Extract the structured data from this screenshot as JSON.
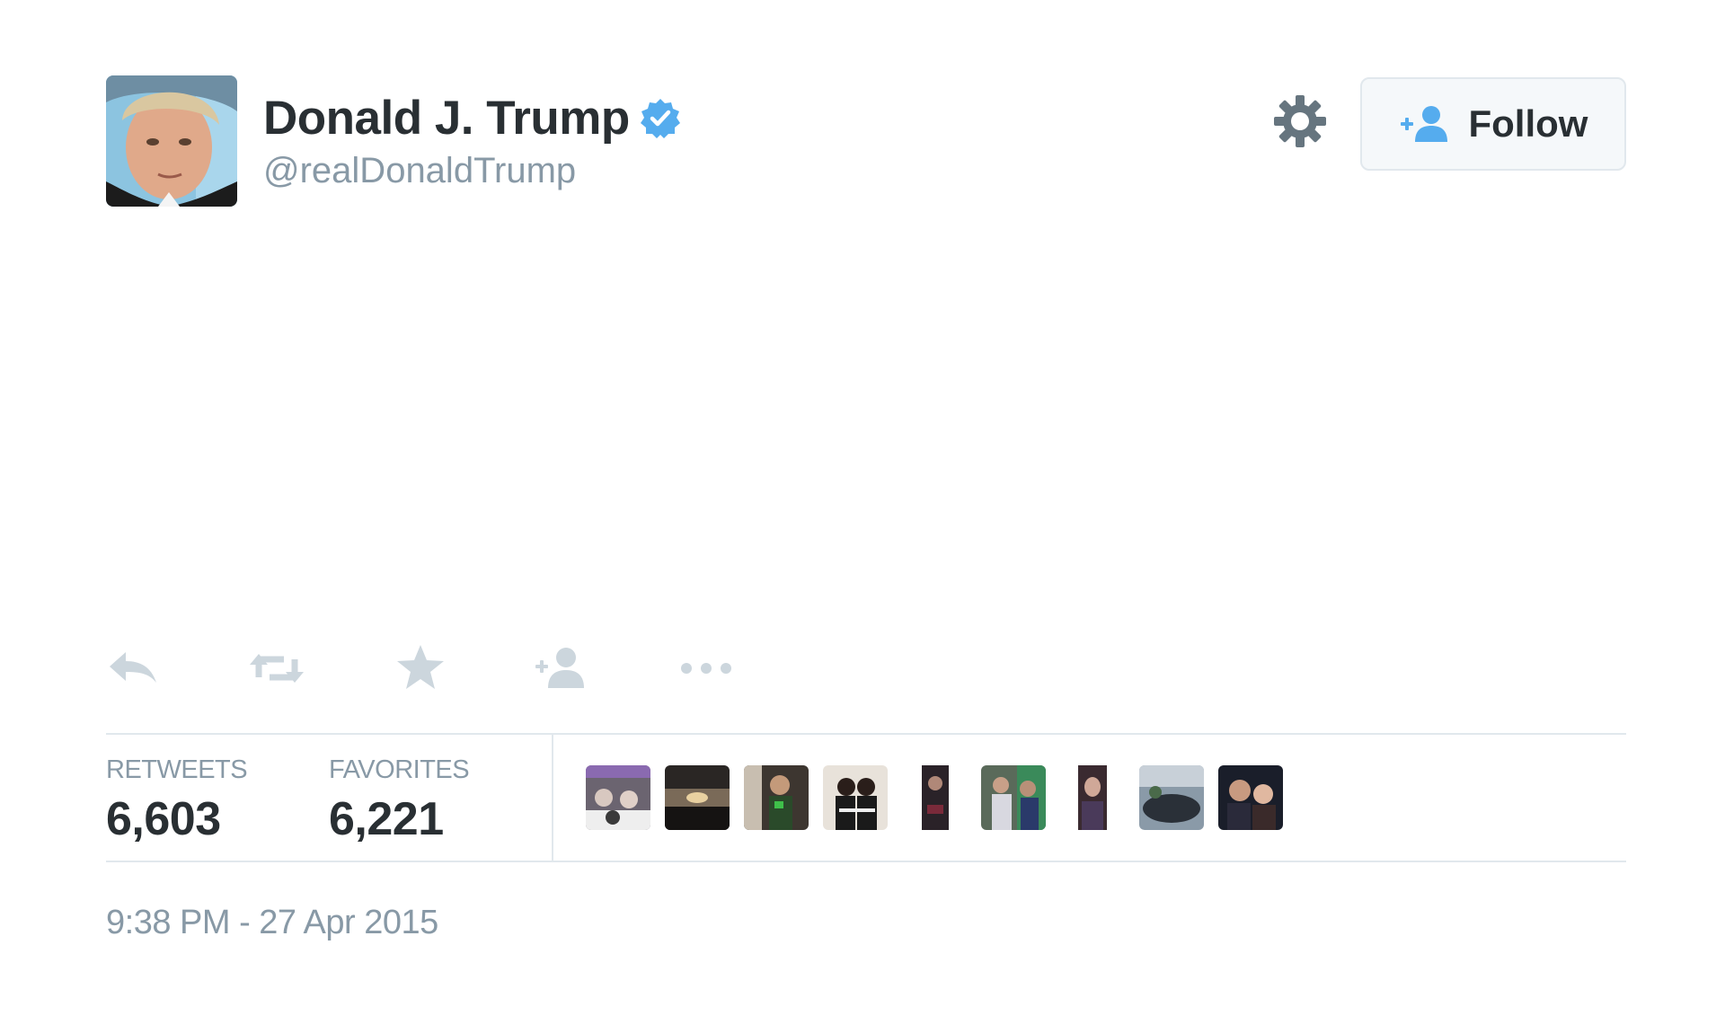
{
  "header": {
    "fullname": "Donald J. Trump",
    "handle": "@realDonaldTrump",
    "verified": true,
    "verified_icon": "verified-badge-icon",
    "settings_icon": "gear-icon",
    "follow_label": "Follow",
    "follow_icon": "add-user-icon"
  },
  "actions": [
    {
      "name": "reply",
      "icon": "reply-icon"
    },
    {
      "name": "retweet",
      "icon": "retweet-icon"
    },
    {
      "name": "favorite",
      "icon": "star-icon"
    },
    {
      "name": "follow",
      "icon": "add-user-icon"
    },
    {
      "name": "more",
      "icon": "more-dots-icon"
    }
  ],
  "stats": {
    "retweets_label": "RETWEETS",
    "retweets_value": "6,603",
    "favorites_label": "FAVORITES",
    "favorites_value": "6,221"
  },
  "favoriter_avatars_count": 9,
  "timestamp": "9:38 PM - 27 Apr 2015",
  "colors": {
    "text": "#292f33",
    "muted": "#8899a6",
    "icon": "#ccd6dd",
    "verified": "#55acee",
    "follow_icon": "#55acee",
    "divider": "#e1e8ed",
    "gear": "#66757f"
  }
}
